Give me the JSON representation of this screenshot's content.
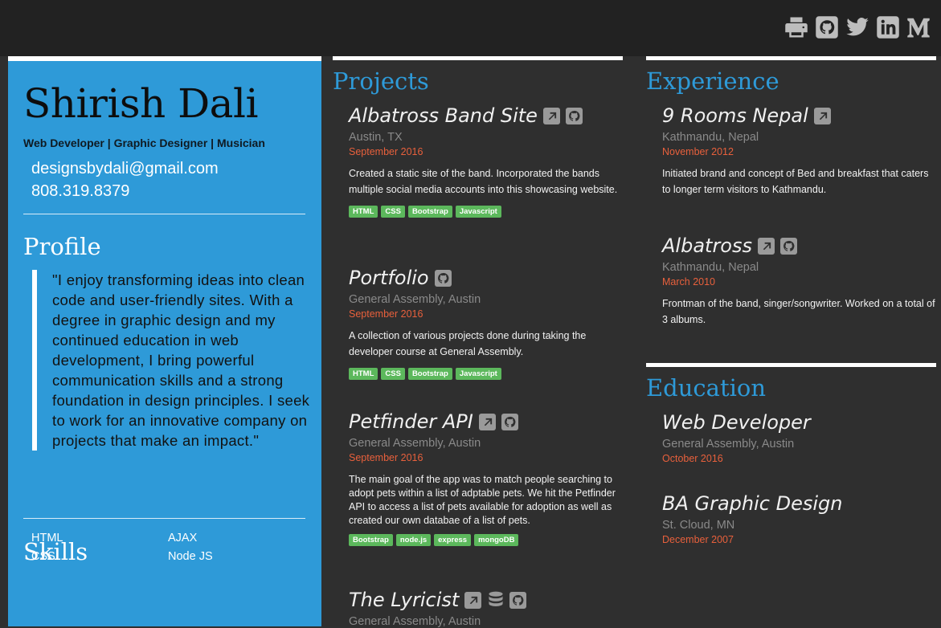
{
  "social": {
    "icons": [
      "print-icon",
      "github-icon",
      "twitter-icon",
      "linkedin-icon",
      "medium-icon"
    ]
  },
  "profile": {
    "name": "Shirish Dali",
    "tagline": "Web Developer | Graphic Designer | Musician",
    "email": "designsbydali@gmail.com",
    "phone": "808.319.8379",
    "profile_title": "Profile",
    "quote": "\"I enjoy transforming ideas into clean code and user-friendly sites. With a degree in graphic design and my continued education in web development, I bring powerful communication skills and a strong foundation in design principles. I seek to work for an innovative company on projects that make an impact.\"",
    "skills_title": "Skills",
    "skills": [
      "HTML",
      "AJAX",
      "CSS",
      "Node JS"
    ]
  },
  "projects": {
    "title": "Projects",
    "items": [
      {
        "name": "Albatross Band Site",
        "location": "Austin, TX",
        "date": "September 2016",
        "desc": "Created a static site of the band. Incorporated the bands multiple social media accounts into this showcasing website.",
        "tags": [
          "HTML",
          "CSS",
          "Bootstrap",
          "Javascript"
        ]
      },
      {
        "name": "Portfolio",
        "location": "General Assembly, Austin",
        "date": "September 2016",
        "desc": "A collection of various projects done during taking the developer course at General Assembly.",
        "tags": [
          "HTML",
          "CSS",
          "Bootstrap",
          "Javascript"
        ]
      },
      {
        "name": "Petfinder API",
        "location": "General Assembly, Austin",
        "date": "September 2016",
        "desc": "The main goal of the app was to match people searching to adopt pets within a list of adptable pets. We hit the Petfinder API to access a list of pets available for adoption as well as created our own databae of a list of pets.",
        "tags": [
          "Bootstrap",
          "node.js",
          "express",
          "mongoDB"
        ]
      },
      {
        "name": "The Lyricist",
        "location": "General Assembly, Austin"
      }
    ]
  },
  "experience": {
    "title": "Experience",
    "items": [
      {
        "name": "9 Rooms Nepal",
        "location": "Kathmandu, Nepal",
        "date": "November 2012",
        "desc": "Initiated brand and concept of Bed and breakfast that caters to longer term visitors to Kathmandu."
      },
      {
        "name": "Albatross",
        "location": "Kathmandu, Nepal",
        "date": "March 2010",
        "desc": "Frontman of the band, singer/songwriter. Worked on a total of 3 albums."
      }
    ]
  },
  "education": {
    "title": "Education",
    "items": [
      {
        "name": "Web Developer",
        "location": "General Assembly, Austin",
        "date": "October 2016"
      },
      {
        "name": "BA Graphic Design",
        "location": "St. Cloud, MN",
        "date": "December 2007"
      }
    ]
  },
  "colors": {
    "accent": "#2e9ad8",
    "date": "#e8603c",
    "tag": "#5cb85c",
    "background": "#2f2f2f",
    "topbar": "#222222"
  }
}
